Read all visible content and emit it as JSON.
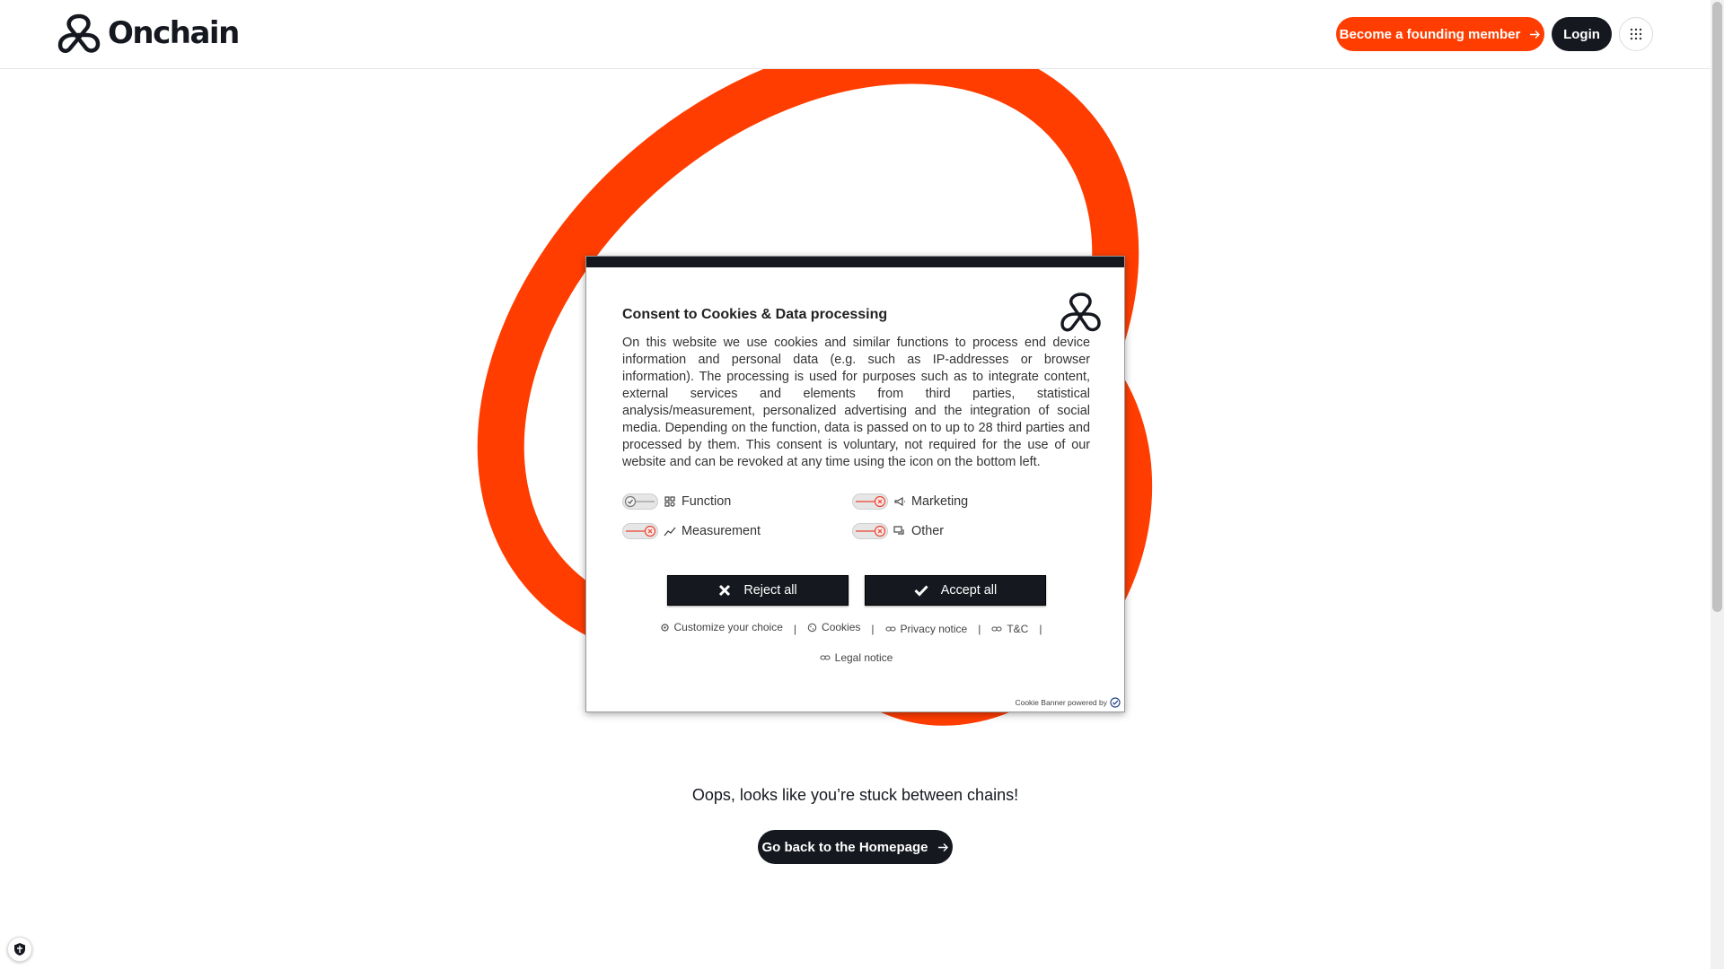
{
  "header": {
    "brand": "Onchain",
    "founding_label": "Become a founding member",
    "login_label": "Login"
  },
  "main": {
    "message": "Oops, looks like you’re stuck between chains!",
    "home_button": "Go back to the Homepage"
  },
  "consent": {
    "title": "Consent to Cookies & Data processing",
    "body": "On this website we use cookies and similar functions to process end device information and personal data (e.g. such as IP-addresses or browser information). The processing is used for purposes such as to integrate content, external services and elements from third parties, statistical analysis/measurement, personalized advertising and the integration of social media. Depending on the function, data is passed on to up to 28 third parties and processed by them. This consent is voluntary, not required for the use of our website and can be revoked at any time using the icon on the bottom left.",
    "options": [
      {
        "label": "Function",
        "icon": "grid-icon",
        "enabled": true
      },
      {
        "label": "Marketing",
        "icon": "megaphone-icon",
        "enabled": false
      },
      {
        "label": "Measurement",
        "icon": "chart-icon",
        "enabled": false
      },
      {
        "label": "Other",
        "icon": "chat-icon",
        "enabled": false
      }
    ],
    "reject_label": "Reject all",
    "accept_label": "Accept all",
    "links": {
      "customize": "Customize your choice",
      "cookies": "Cookies",
      "privacy": "Privacy notice",
      "tc": "T&C",
      "legal": "Legal notice"
    },
    "powered_by": "Cookie Banner powered by"
  },
  "colors": {
    "brand_orange": "#ff3d00",
    "dark": "#15181f",
    "toggle_off_x": "#e8442f"
  }
}
